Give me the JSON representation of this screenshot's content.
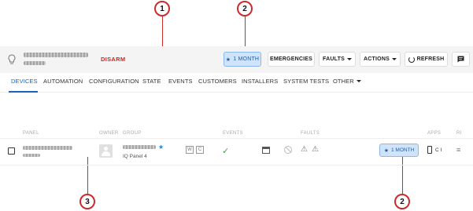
{
  "callouts": [
    "1",
    "2",
    "2",
    "3"
  ],
  "header": {
    "disarm_label": "DISARM",
    "month_button": "1 MONTH",
    "emergencies_button": "EMERGENCIES",
    "faults_button": "FAULTS",
    "actions_button": "ACTIONS",
    "refresh_button": "REFRESH"
  },
  "nav": {
    "tabs": [
      "DEVICES",
      "AUTOMATION",
      "CONFIGURATION",
      "STATE",
      "EVENTS",
      "CUSTOMERS",
      "INSTALLERS",
      "SYSTEM TESTS",
      "OTHER"
    ],
    "active_tab": "DEVICES"
  },
  "table": {
    "headers": [
      "PANEL",
      "OWNER",
      "GROUP",
      "EVENTS",
      "FAULTS",
      "APPS",
      "RI"
    ],
    "row": {
      "group_sub": "IQ Panel 4",
      "month_button": "1 MONTH",
      "apps_text": "C I"
    }
  },
  "colors": {
    "accent": "#1565c0",
    "disarm": "#c62828",
    "highlight_bg": "#cfe3fb",
    "callout": "#cc2b2b",
    "ok": "#43a047"
  },
  "icons": [
    "bulb-icon",
    "star-icon",
    "caret-down-icon",
    "refresh-icon",
    "message-icon",
    "avatar-icon",
    "check-icon",
    "panel-icon",
    "ban-icon",
    "warning-icon",
    "phone-icon",
    "menu-lines-icon"
  ]
}
